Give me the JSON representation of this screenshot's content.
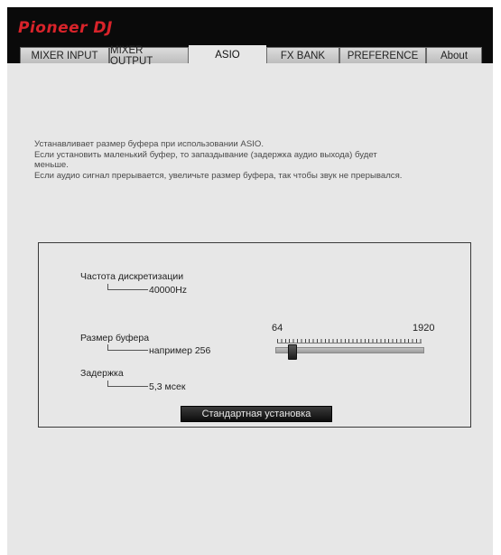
{
  "app": {
    "logo_text": "Pioneer DJ"
  },
  "tabs": [
    {
      "label": "MIXER INPUT",
      "active": false
    },
    {
      "label": "MIXER OUTPUT",
      "active": false
    },
    {
      "label": "ASIO",
      "active": true
    },
    {
      "label": "FX BANK",
      "active": false
    },
    {
      "label": "PREFERENCE",
      "active": false
    },
    {
      "label": "About",
      "active": false
    }
  ],
  "description": {
    "line1": "Устанавливает размер буфера при использовании ASIO.",
    "line2": "Если установить маленький буфер, то запаздывание (задержка аудио выхода) будет",
    "line3": "меньше.",
    "line4": "Если аудио сигнал прерывается, увеличьте размер буфера, так чтобы звук не прерывался."
  },
  "settings": {
    "sample_rate_label": "Частота дискретизации",
    "sample_rate_value": "40000Hz",
    "buffer_size_label": "Размер буфера",
    "buffer_size_value": "например 256",
    "latency_label": "Задержка",
    "latency_value": "5,3 мсек",
    "slider_min_label": "64",
    "slider_max_label": "1920",
    "slider_value": 256,
    "default_button_label": "Стандартная установка"
  },
  "colors": {
    "brand": "#d8232a",
    "header_bg": "#0a0a0a",
    "content_bg": "#e7e7e7"
  }
}
